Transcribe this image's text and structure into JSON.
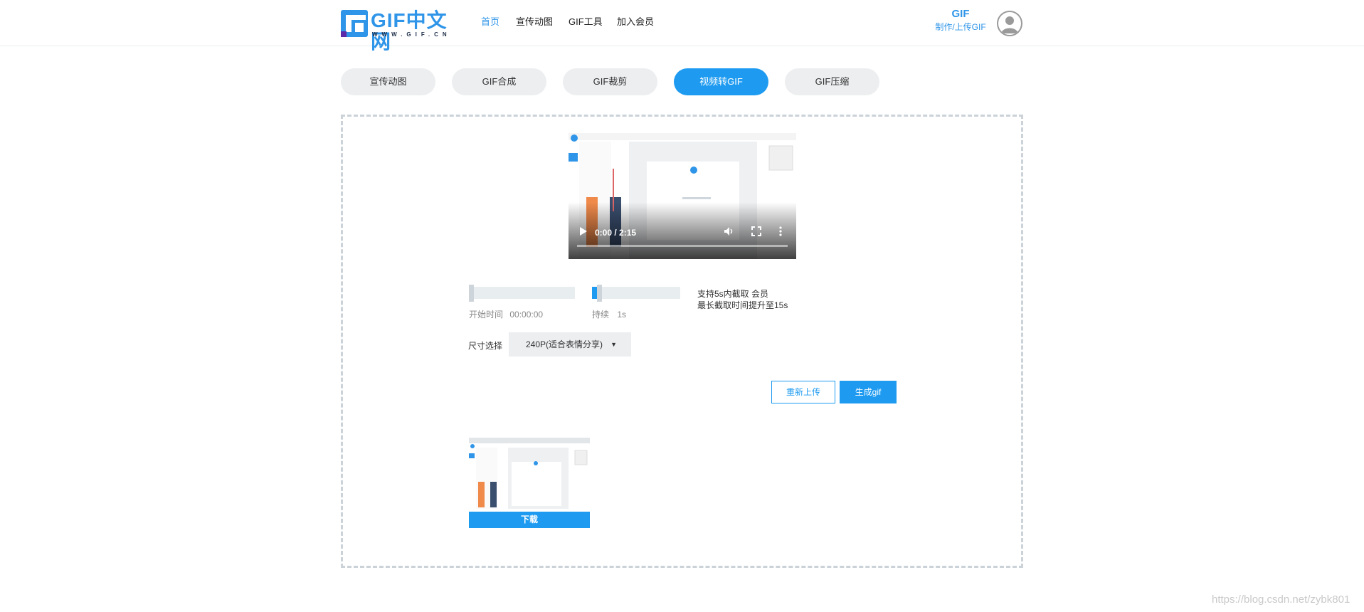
{
  "header": {
    "logo_text": "GIF中文网",
    "logo_sub": "WWW.GIF.CN",
    "nav": [
      "首页",
      "宣传动图",
      "GIF工具",
      "加入会员"
    ],
    "active_nav": "首页",
    "gif_badge_title": "GIF",
    "gif_badge_sub": "制作/上传GIF"
  },
  "tabs": [
    "宣传动图",
    "GIF合成",
    "GIF裁剪",
    "视频转GIF",
    "GIF压缩"
  ],
  "active_tab": "视频转GIF",
  "video": {
    "time": "0:00 / 2:15",
    "progress": 0.0
  },
  "start_slider": {
    "label": "开始时间",
    "value": "00:00:00",
    "fill": 0.0
  },
  "duration_slider": {
    "label": "持续",
    "value": "1s",
    "fill": 0.0667
  },
  "notes": [
    "支持5s内截取 会员",
    "最长截取时间提升至15s"
  ],
  "size": {
    "label": "尺寸选择",
    "selected": "240P(适合表情分享)"
  },
  "buttons": {
    "reupload": "重新上传",
    "generate": "生成gif",
    "download": "下载"
  },
  "watermark": "https://blog.csdn.net/zybk801",
  "colors": {
    "accent": "#1e9bf0",
    "tab_bg": "#eceef0",
    "dashed_border": "#cbd3d9"
  }
}
